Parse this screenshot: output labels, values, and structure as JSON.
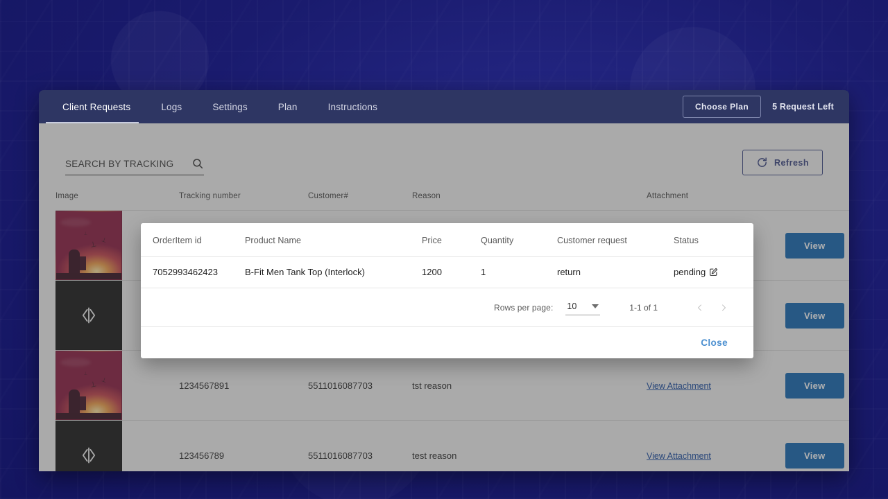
{
  "navbar": {
    "tabs": [
      {
        "label": "Client Requests",
        "active": true
      },
      {
        "label": "Logs",
        "active": false
      },
      {
        "label": "Settings",
        "active": false
      },
      {
        "label": "Plan",
        "active": false
      },
      {
        "label": "Instructions",
        "active": false
      }
    ],
    "choose_plan_label": "Choose Plan",
    "requests_left": "5 Request Left",
    "bg_color": "#2e3663"
  },
  "toolbar": {
    "search_placeholder": "SEARCH BY TRACKING",
    "search_value": "",
    "search_icon": "search-icon",
    "refresh_label": "Refresh",
    "refresh_icon": "refresh-icon",
    "refresh_color": "#3f4a86"
  },
  "table": {
    "headers": [
      "Image",
      "Tracking number",
      "Customer#",
      "Reason",
      "Attachment",
      ""
    ],
    "rows": [
      {
        "thumb": "photo",
        "tracking": "",
        "customer": "",
        "reason": "",
        "attachment": "",
        "action": "View"
      },
      {
        "thumb": "code",
        "tracking": "",
        "customer": "",
        "reason": "",
        "attachment": "",
        "action": "View"
      },
      {
        "thumb": "photo",
        "tracking": "1234567891",
        "customer": "5511016087703",
        "reason": "tst reason",
        "attachment": "View Attachment",
        "action": "View"
      },
      {
        "thumb": "code",
        "tracking": "123456789",
        "customer": "5511016087703",
        "reason": "test reason",
        "attachment": "View Attachment",
        "action": "View"
      }
    ],
    "view_button_color": "#1a6bb5",
    "link_color": "#1d4fa3"
  },
  "modal": {
    "headers": [
      "OrderItem id",
      "Product Name",
      "Price",
      "Quantity",
      "Customer request",
      "Status"
    ],
    "rows": [
      {
        "order_item_id": "7052993462423",
        "product_name": "B-Fit Men Tank Top (Interlock)",
        "price": "1200",
        "quantity": "1",
        "customer_request": "return",
        "status": "pending",
        "status_icon": "edit-icon"
      }
    ],
    "pagination": {
      "rows_per_page_label": "Rows per page:",
      "rows_per_page_value": "10",
      "dropdown_icon": "chevron-down-icon",
      "range_label": "1-1 of 1",
      "prev_icon": "chevron-left-icon",
      "next_icon": "chevron-right-icon"
    },
    "close_label": "Close",
    "close_color": "#4b8fd0"
  }
}
